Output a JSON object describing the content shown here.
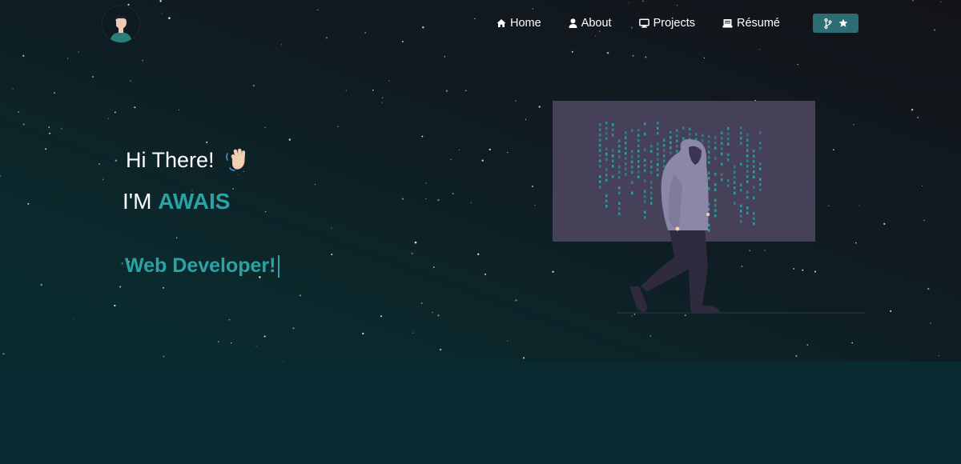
{
  "nav": {
    "items": [
      {
        "label": "Home",
        "icon": "home-icon"
      },
      {
        "label": "About",
        "icon": "user-icon"
      },
      {
        "label": "Projects",
        "icon": "monitor-icon"
      },
      {
        "label": "Résumé",
        "icon": "document-icon"
      }
    ],
    "github_button": {
      "icons": [
        "git-fork-icon",
        "star-icon"
      ],
      "color": "#2c6d73"
    }
  },
  "hero": {
    "greeting": "Hi There!",
    "greeting_icon": "waving-hand-icon",
    "intro_prefix": "I'M ",
    "name": "AWAIS",
    "typed_text": "Web Developer!",
    "accent_color": "#2aa3a6"
  },
  "illustration": {
    "description_icon": "hacker-walking-illustration",
    "screen_color": "#464059",
    "code_color": "#2aa3a6"
  }
}
